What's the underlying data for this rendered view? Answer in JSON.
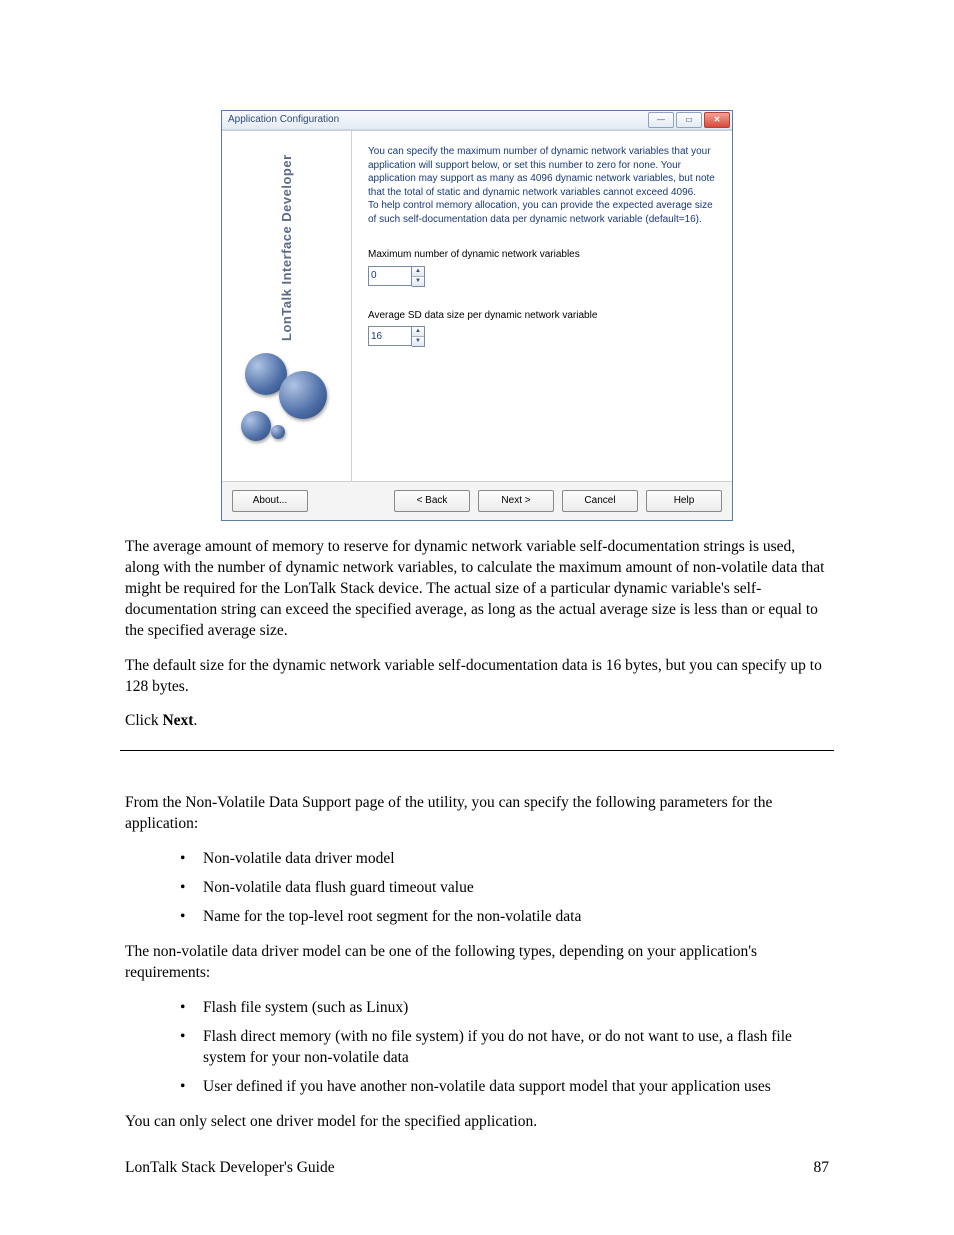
{
  "dialog": {
    "title": "Application Configuration",
    "instructions_p1": "You can specify the maximum number of dynamic network variables that your application will support below, or set this number to zero for none. Your application may support as many as 4096 dynamic network variables, but note that the total of static and dynamic network variables cannot exceed 4096.",
    "instructions_p2": "To help control memory allocation, you can provide the expected average size of such self-documentation data per dynamic network variable (default=16).",
    "field1_label": "Maximum number of dynamic network variables",
    "field1_value": "0",
    "field2_label": "Average SD data size per dynamic network variable",
    "field2_value": "16",
    "side_label": "LonTalk Interface Developer",
    "buttons": {
      "about": "About...",
      "back": "< Back",
      "next": "Next >",
      "cancel": "Cancel",
      "help": "Help"
    }
  },
  "doc": {
    "p1": "The average amount of memory to reserve for dynamic network variable self-documentation strings is used, along with the number of dynamic network variables, to calculate the maximum amount of non-volatile data that might be required for the LonTalk Stack device.  The actual size of a particular dynamic variable's self-documentation string can exceed the specified average, as long as the actual average size is less than or equal to the specified average size.",
    "p2": "The default size for the dynamic network variable self-documentation data is 16 bytes, but you can specify up to 128 bytes.",
    "p3_pre": "Click ",
    "p3_bold": "Next",
    "p3_post": ".",
    "p4": "From the Non-Volatile Data Support page of the utility, you can specify the following parameters for the application:",
    "list1": [
      "Non-volatile data driver model",
      "Non-volatile data flush guard timeout value",
      "Name for the top-level root segment for the non-volatile data"
    ],
    "p5": "The non-volatile data driver model can be one of the following types, depending on your application's requirements:",
    "list2": [
      "Flash file system (such as Linux)",
      "Flash direct memory (with no file system) if you do not have, or do not want to use, a flash file system for your non-volatile data",
      "User defined if you have another non-volatile data support model that your application uses"
    ],
    "p6": "You can only select one driver model for the specified application.",
    "footer_left": "LonTalk Stack Developer's Guide",
    "footer_right": "87"
  }
}
